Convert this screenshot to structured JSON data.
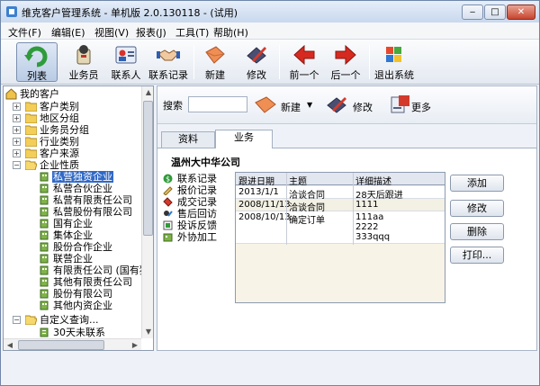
{
  "window": {
    "title": "维克客户管理系统 - 单机版 2.0.130118 - (试用)"
  },
  "menu": [
    "文件(F)",
    "编辑(E)",
    "视图(V)",
    "报表(J)",
    "工具(T)",
    "帮助(H)"
  ],
  "toolbar": {
    "list": "列表",
    "salesman": "业务员",
    "contact": "联系人",
    "contact_record": "联系记录",
    "new": "新建",
    "edit": "修改",
    "prev": "前一个",
    "next": "后一个",
    "exit": "退出系统"
  },
  "tree": {
    "root": "我的客户",
    "items": [
      {
        "label": "客户类别"
      },
      {
        "label": "地区分组"
      },
      {
        "label": "业务员分组"
      },
      {
        "label": "行业类别"
      },
      {
        "label": "客户来源"
      },
      {
        "label": "企业性质"
      }
    ],
    "enterprise_children": [
      "私营独资企业",
      "私营合伙企业",
      "私营有限责任公司",
      "私营股份有限公司",
      "国有企业",
      "集体企业",
      "股份合作企业",
      "联营企业",
      "有限责任公司 (国有独",
      "其他有限责任公司",
      "股份有限公司",
      "其他内资企业"
    ],
    "custom_query": "自定义查询...",
    "custom_children": [
      "30天未联系"
    ]
  },
  "search": {
    "label": "搜索",
    "value": "",
    "new": "新建",
    "edit": "修改",
    "more": "更多"
  },
  "tabs": [
    "资料",
    "业务"
  ],
  "company": "温州大中华公司",
  "categories": [
    "联系记录",
    "报价记录",
    "成交记录",
    "售后回访",
    "投诉反馈",
    "外协加工"
  ],
  "table": {
    "headers": [
      "跟进日期",
      "主题",
      "详细描述"
    ],
    "rows": [
      {
        "date": "2013/1/1",
        "subject": "洽谈合同",
        "desc": [
          "28天后跟进"
        ]
      },
      {
        "date": "2008/11/13",
        "subject": "洽谈合同",
        "desc": [
          "1111"
        ]
      },
      {
        "date": "2008/10/13",
        "subject": "确定订单",
        "desc": [
          "111aa",
          "2222",
          "333qqq"
        ]
      }
    ]
  },
  "actions": {
    "add": "添加",
    "edit": "修改",
    "delete": "删除",
    "print": "打印..."
  },
  "colors": {
    "accent": "#3169c6",
    "title_bg": "#c8d8ee",
    "grid_bg": "#f7f3e6"
  }
}
